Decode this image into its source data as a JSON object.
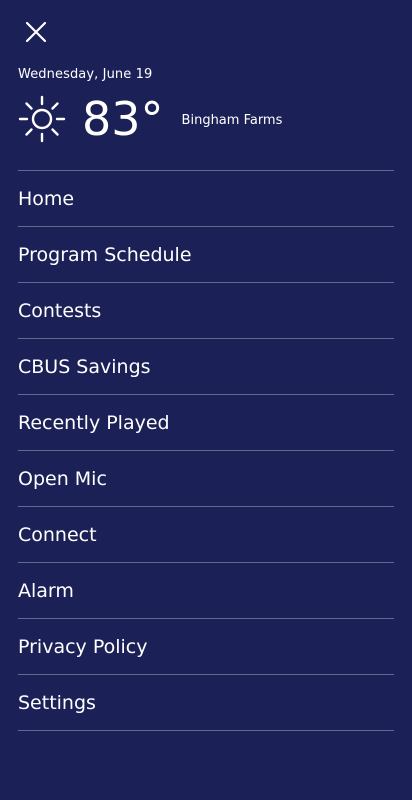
{
  "header": {
    "close_icon": "close-icon",
    "date": "Wednesday, June 19"
  },
  "weather": {
    "icon": "sun-icon",
    "temperature": "83°",
    "location": "Bingham Farms"
  },
  "menu": {
    "items": [
      {
        "label": "Home"
      },
      {
        "label": "Program Schedule"
      },
      {
        "label": "Contests"
      },
      {
        "label": "CBUS Savings"
      },
      {
        "label": "Recently Played"
      },
      {
        "label": "Open Mic"
      },
      {
        "label": "Connect"
      },
      {
        "label": "Alarm"
      },
      {
        "label": "Privacy Policy"
      },
      {
        "label": "Settings"
      }
    ]
  },
  "colors": {
    "background": "#1b2157",
    "text": "#ffffff",
    "divider": "rgba(255,255,255,0.32)"
  }
}
